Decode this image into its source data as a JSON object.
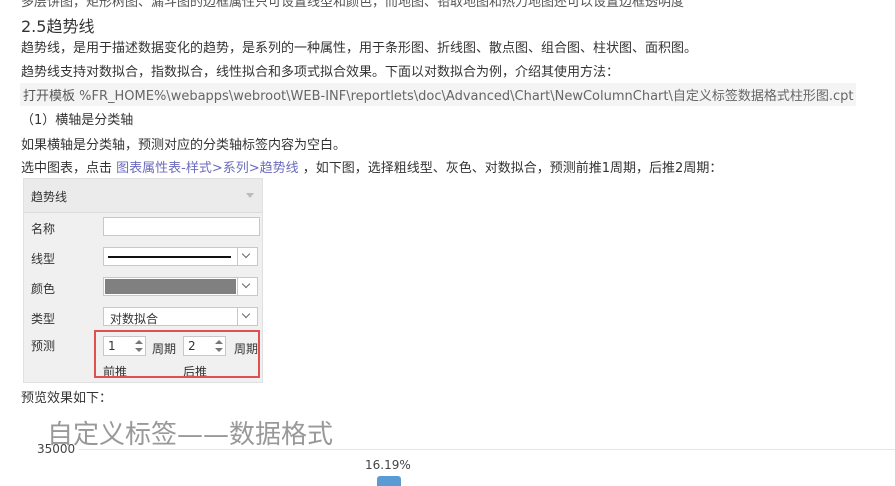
{
  "doc": {
    "cut_line": "多层饼图，矩形树图、漏斗图的边框属性只可设置线型和颜色，而地图、铅取地图和热力地图还可以设置边框透明度",
    "section_title": "2.5趋势线",
    "para1": "趋势线，是用于描述数据变化的趋势，是系列的一种属性，用于条形图、折线图、散点图、组合图、柱状图、面积图。",
    "para2": "趋势线支持对数拟合，指数拟合，线性拟合和多项式拟合效果。下面以对数拟合为例，介绍其使用方法：",
    "open_prefix": "打开模板",
    "template_path": "%FR_HOME%\\webapps\\webroot\\WEB-INF\\reportlets\\doc\\Advanced\\Chart\\NewColumnChart\\自定义标签数据格式柱形图.cpt",
    "subheading": "（1）横轴是分类轴",
    "para3": "如果横轴是分类轴，预测对应的分类轴标签内容为空白。",
    "para4_prefix": "选中图表，点击",
    "para4_link": "图表属性表-样式>系列>趋势线",
    "para4_suffix": "，如下图，选择粗线型、灰色、对数拟合，预测前推1周期，后推2周期：",
    "preview_label": "预览效果如下："
  },
  "panel": {
    "header": "趋势线",
    "name_label": "名称",
    "name_value": "",
    "line_label": "线型",
    "color_label": "颜色",
    "color_value": "#808080",
    "type_label": "类型",
    "type_value": "对数拟合",
    "forecast_label": "预测",
    "forward_value": "1",
    "backward_value": "2",
    "period_unit": "周期",
    "forward_label": "前推",
    "backward_label": "后推"
  },
  "chart_data": {
    "type": "bar",
    "title": "自定义标签——数据格式",
    "y_tick_top": "35000",
    "data_labels": [
      "16.19%"
    ]
  }
}
